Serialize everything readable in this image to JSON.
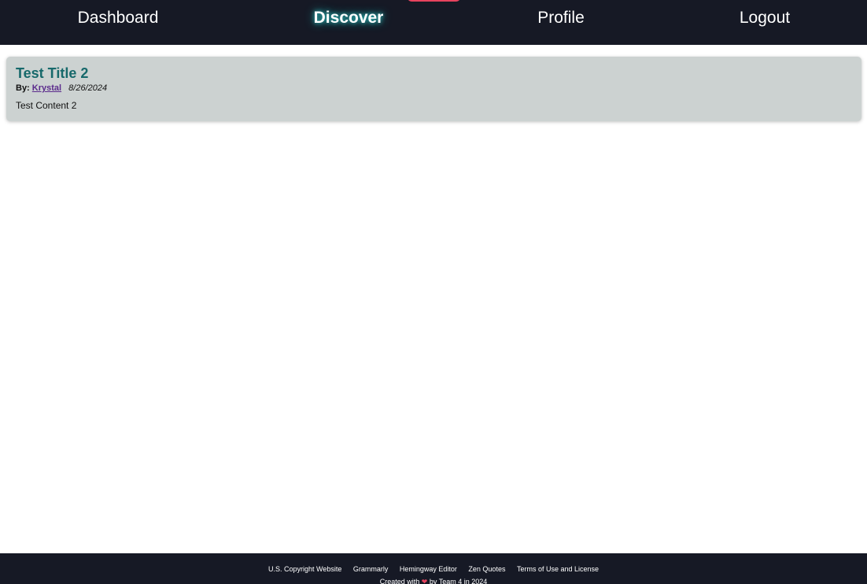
{
  "nav": {
    "items": [
      {
        "label": "Dashboard"
      },
      {
        "label": "Discover",
        "active": true
      },
      {
        "label": "Profile"
      },
      {
        "label": "Logout"
      }
    ]
  },
  "post": {
    "title": "Test Title 2",
    "by_label": "By:",
    "author": "Krystal",
    "date": "8/26/2024",
    "content": "Test Content 2"
  },
  "footer": {
    "links": [
      "U.S. Copyright Website",
      "Grammarly",
      "Hemingway Editor",
      "Zen Quotes",
      "Terms of Use and License"
    ],
    "credit_prefix": "Created with",
    "heart_icon": "heart-icon",
    "credit_suffix": "by Team 4 in 2024"
  },
  "colors": {
    "nav_background": "#161925",
    "active_marker": "#e8435e",
    "card_background": "#ccd2d1",
    "title_color": "#17696b",
    "author_link": "#5b2b8c"
  }
}
